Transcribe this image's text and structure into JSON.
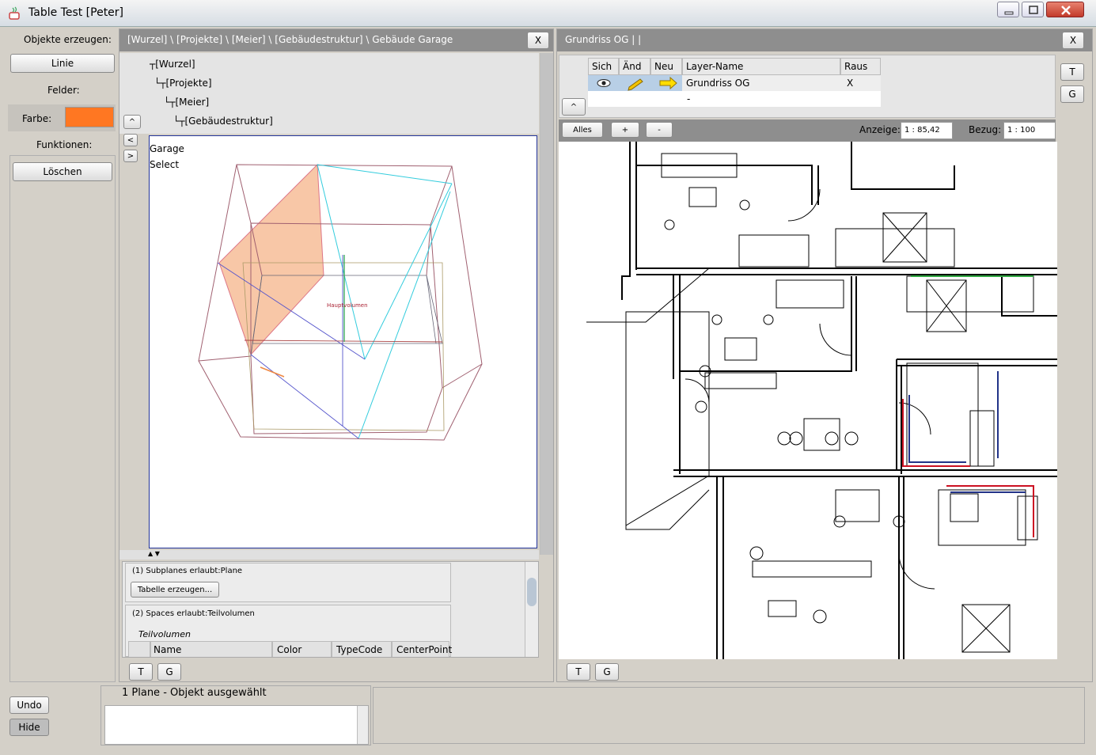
{
  "window": {
    "title": "Table Test [Peter]"
  },
  "left_sidebar": {
    "create_label": "Objekte erzeugen:",
    "linie_button": "Linie",
    "fields_label": "Felder:",
    "color_label": "Farbe:",
    "color_value": "#ff7722",
    "functions_label": "Funktionen:",
    "delete_button": "Löschen",
    "undo_button": "Undo",
    "hide_button": "Hide"
  },
  "center_panel": {
    "breadcrumb": "[Wurzel] \\ [Projekte] \\ [Meier] \\ [Gebäudestruktur] \\ Gebäude Garage",
    "close": "X",
    "nav_up": "^",
    "nav_left": "<",
    "nav_right": ">",
    "tree": [
      "┬[Wurzel]",
      "└┬[Projekte]",
      "└┬[Meier]",
      "└┬[Gebäudestruktur]"
    ],
    "view_lines": [
      "Garage",
      "Select"
    ],
    "view_annotation": "Hauptvolumen",
    "split_arrows": "▲ ▼",
    "section1_title": "(1) Subplanes erlaubt:Plane",
    "section1_button": "Tabelle erzeugen...",
    "section2_title": "(2) Spaces erlaubt:Teilvolumen",
    "section2_subtitle": "Teilvolumen",
    "table_columns": [
      "Name",
      "Color",
      "TypeCode",
      "CenterPoint"
    ],
    "t_button": "T",
    "g_button": "G"
  },
  "right_panel": {
    "title": "Grundriss OG |  |",
    "close": "X",
    "layer_columns": [
      "Sich",
      "Änd",
      "Neu",
      "Layer-Name",
      "Raus"
    ],
    "layer_rows": [
      {
        "name": "Grundriss OG",
        "raus": "X"
      },
      {
        "name": "-",
        "raus": ""
      }
    ],
    "up_button": "^",
    "all_button": "Alles",
    "plus_button": "+",
    "minus_button": "-",
    "display_label": "Anzeige:",
    "display_value": "1 : 85,42",
    "ref_label": "Bezug:",
    "ref_value": "1 : 100",
    "side_t": "T",
    "side_g": "G",
    "t_button": "T",
    "g_button": "G"
  },
  "status": {
    "message": "1 Plane - Objekt ausgewählt"
  }
}
